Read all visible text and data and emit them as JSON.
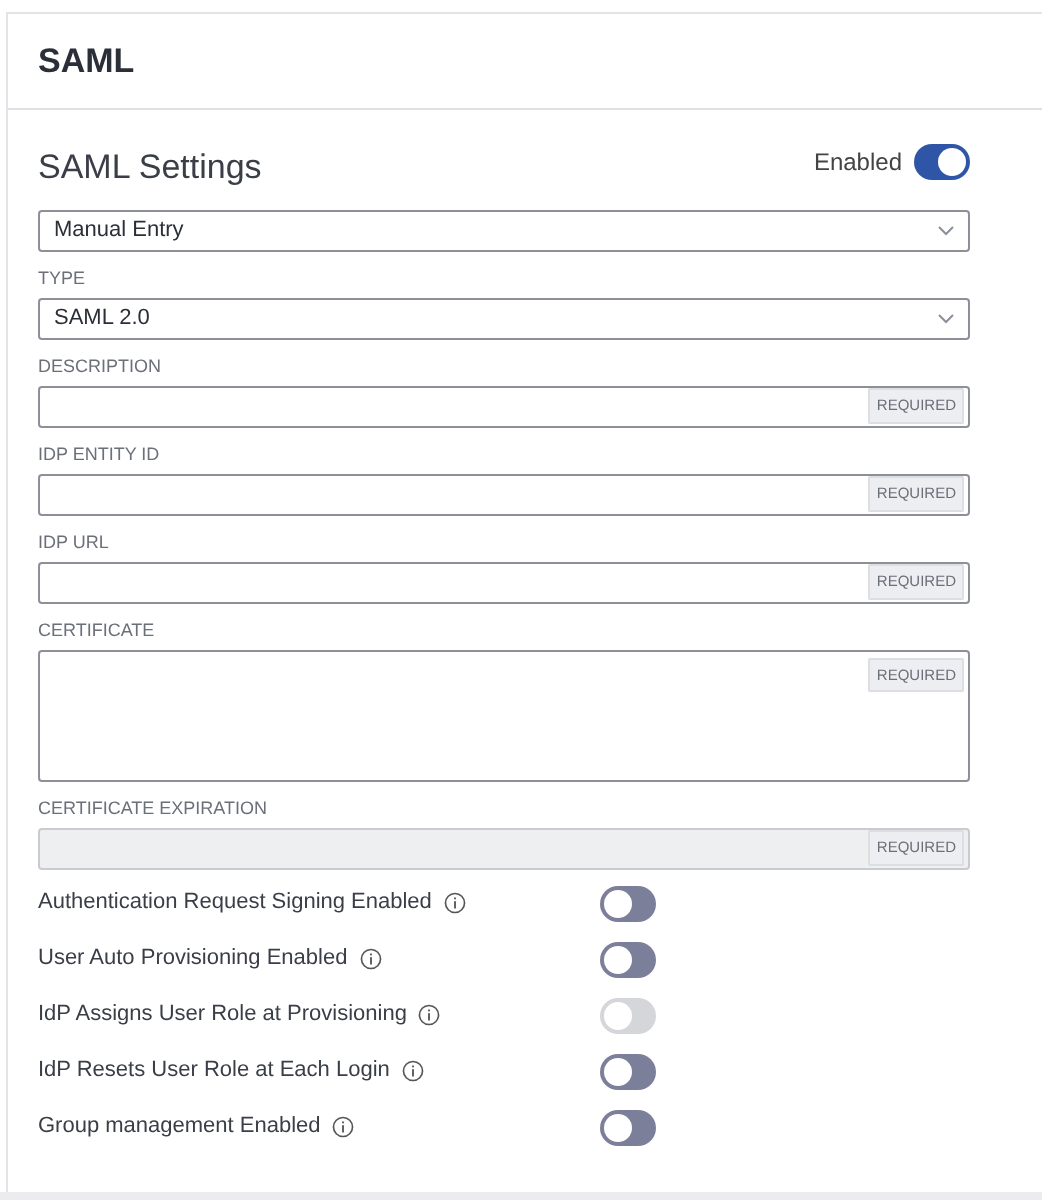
{
  "page_title": "SAML",
  "section": {
    "title": "SAML Settings",
    "enabled_label": "Enabled",
    "enabled": true
  },
  "fields": [
    {
      "kind": "select",
      "value": "Manual Entry"
    },
    {
      "kind": "select",
      "label": "TYPE",
      "value": "SAML 2.0"
    },
    {
      "kind": "input",
      "label": "DESCRIPTION",
      "badge": "REQUIRED",
      "disabled": false
    },
    {
      "kind": "input",
      "label": "IDP ENTITY ID",
      "badge": "REQUIRED",
      "disabled": false
    },
    {
      "kind": "input",
      "label": "IDP URL",
      "badge": "REQUIRED",
      "disabled": false
    },
    {
      "kind": "textarea",
      "label": "CERTIFICATE",
      "badge": "REQUIRED",
      "disabled": false
    },
    {
      "kind": "input",
      "label": "CERTIFICATE EXPIRATION",
      "badge": "REQUIRED",
      "disabled": true
    }
  ],
  "toggles": [
    {
      "label": "Authentication Request Signing Enabled",
      "on": false,
      "disabled": false
    },
    {
      "label": "User Auto Provisioning Enabled",
      "on": false,
      "disabled": false
    },
    {
      "label": "IdP Assigns User Role at Provisioning",
      "on": false,
      "disabled": true
    },
    {
      "label": "IdP Resets User Role at Each Login",
      "on": false,
      "disabled": false
    },
    {
      "label": "Group management Enabled",
      "on": false,
      "disabled": false
    }
  ]
}
